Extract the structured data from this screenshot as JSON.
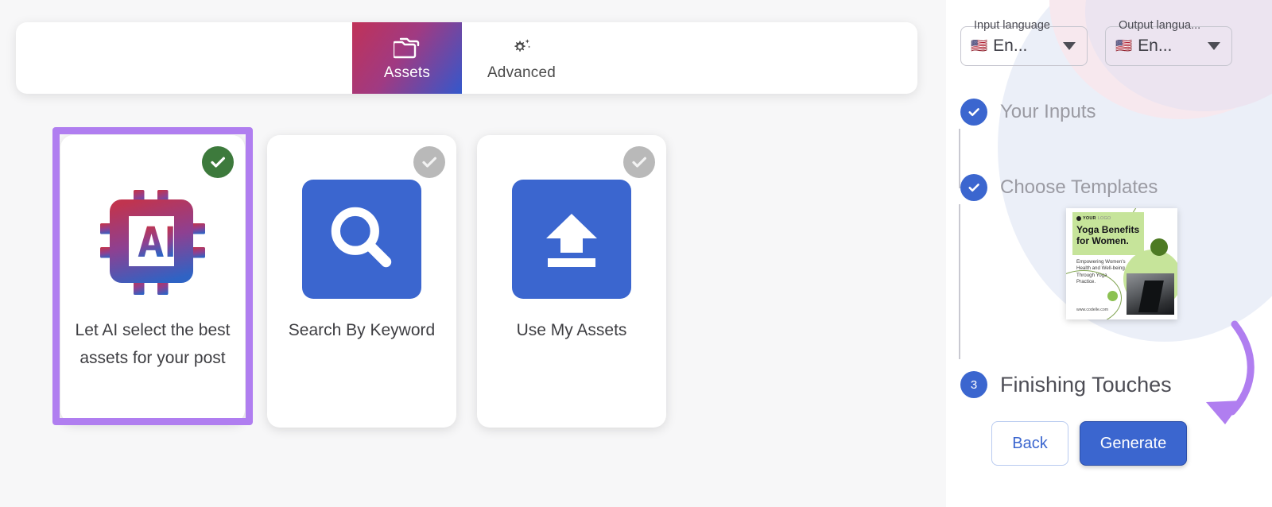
{
  "tabs": [
    {
      "label": "Assets",
      "icon": "folder-icon",
      "active": true
    },
    {
      "label": "Advanced",
      "icon": "gear-sparkle-icon",
      "active": false
    }
  ],
  "asset_options": [
    {
      "caption": "Let AI select the best assets for your post",
      "icon": "ai-chip-icon",
      "selected": true,
      "badge": "check-badge-selected"
    },
    {
      "caption": "Search By Keyword",
      "icon": "magnifier-icon",
      "selected": false,
      "badge": "check-badge-unselected"
    },
    {
      "caption": "Use My Assets",
      "icon": "upload-icon",
      "selected": false,
      "badge": "check-badge-unselected"
    }
  ],
  "language": {
    "input": {
      "label": "Input language",
      "value": "En...",
      "flag": "🇺🇸"
    },
    "output": {
      "label": "Output langua...",
      "value": "En...",
      "flag": "🇺🇸"
    }
  },
  "stepper": {
    "steps": [
      {
        "label": "Your Inputs",
        "marker": "✓",
        "state": "complete"
      },
      {
        "label": "Choose Templates",
        "marker": "✓",
        "state": "complete"
      },
      {
        "label": "Finishing Touches",
        "marker": "3",
        "state": "current"
      }
    ]
  },
  "template_preview": {
    "logo_brand": "YOUR",
    "logo_suffix": "LOGO",
    "headline": "Yoga Benefits for Women.",
    "body": "Empowering Women's Health and Well-being Through Yoga Practice.",
    "url": "www.codelle.com"
  },
  "buttons": {
    "back": "Back",
    "generate": "Generate"
  },
  "colors": {
    "accent_blue": "#3b66cf",
    "tab_gradient_start": "#c03258",
    "tab_gradient_end": "#3358cc",
    "badge_selected_green": "#3d7a3c",
    "badge_unselected_gray": "#b9b9b9",
    "annotation_purple": "#b07ef0",
    "step_label_gray": "#9a9aa2"
  }
}
